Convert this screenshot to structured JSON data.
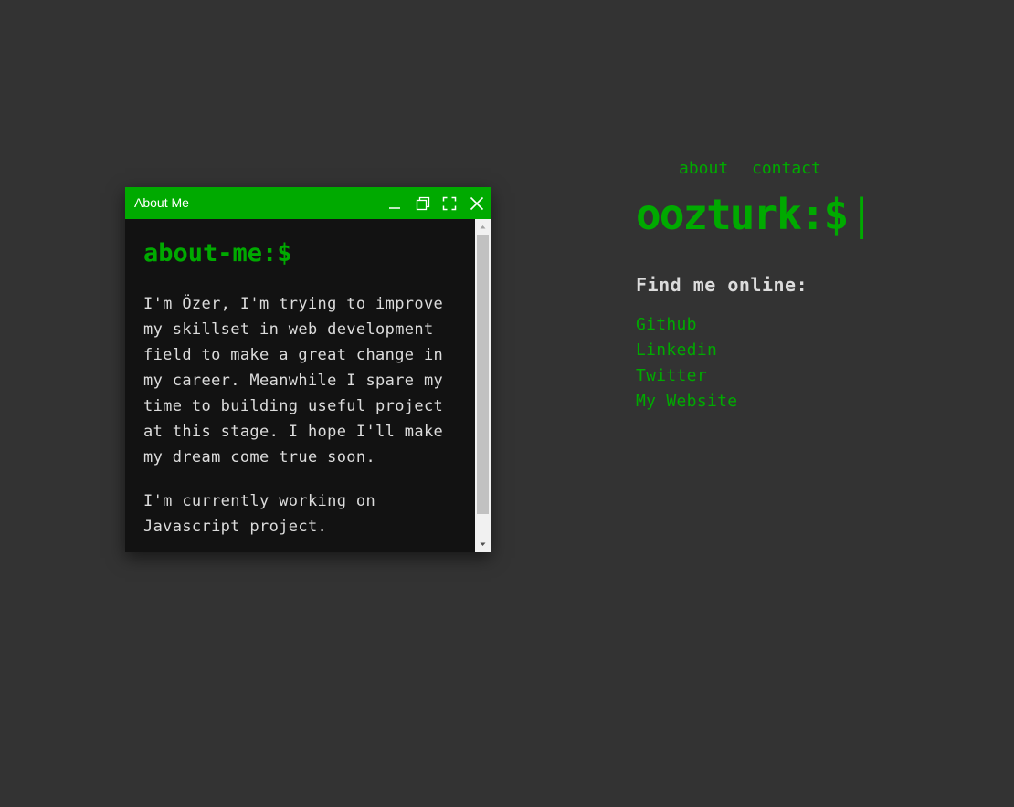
{
  "window": {
    "title": "About Me",
    "heading": "about-me:$",
    "paragraphs": [
      "I'm Özer, I'm trying to improve\nmy skillset in web development\nfield to make a great change in\nmy career. Meanwhile I spare my\ntime to building useful project\nat this stage. I hope I'll make\nmy dream come true soon.",
      "I'm currently working on\nJavascript project."
    ],
    "controls": {
      "minimize": "minimize-icon",
      "restore": "restore-icon",
      "maximize": "maximize-icon",
      "close": "close-icon"
    }
  },
  "nav": {
    "about": "about",
    "contact": "contact"
  },
  "logo": {
    "text": "oozturk:$",
    "cursor": "|"
  },
  "find": {
    "title": "Find me online:",
    "links": [
      "Github",
      "Linkedin",
      "Twitter",
      "My Website"
    ]
  },
  "colors": {
    "background": "#333333",
    "accent": "#00aa00",
    "window_body": "#121212",
    "text": "#dcdcdc"
  }
}
